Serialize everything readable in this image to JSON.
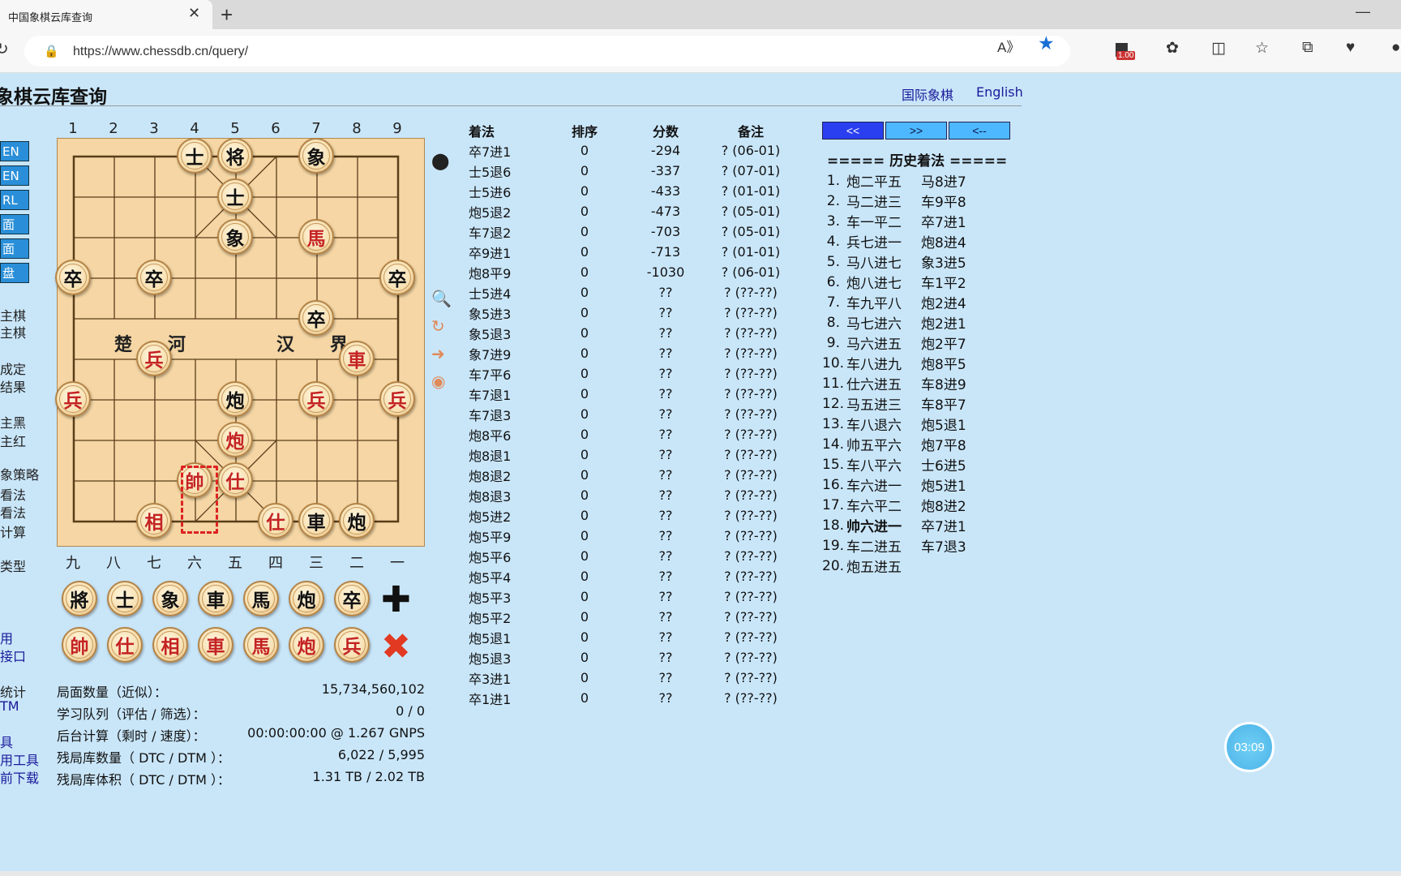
{
  "browser": {
    "tab_title": "中国象棋云库查询",
    "url": "https://www.chessdb.cn/query/",
    "ext_badge": "1.00"
  },
  "page": {
    "title": "象棋云库查询",
    "link_intl": "国际象棋",
    "link_en": "English"
  },
  "left_buttons": [
    "EN",
    "EN",
    "RL",
    "面",
    "面",
    "盘"
  ],
  "left_texts": [
    "主棋",
    "主棋",
    "成定",
    "结果",
    "主黑",
    "主红",
    "象策略",
    "看法",
    "看法",
    "计算",
    "类型",
    "用",
    "接口",
    "统计",
    "TM",
    "具",
    "用工具",
    "前下载"
  ],
  "board": {
    "top_coords": [
      "1",
      "2",
      "3",
      "4",
      "5",
      "6",
      "7",
      "8",
      "9"
    ],
    "bottom_coords": [
      "九",
      "八",
      "七",
      "六",
      "五",
      "四",
      "三",
      "二",
      "一"
    ],
    "river_text": [
      "楚",
      "河",
      "汉",
      "界"
    ],
    "pieces": [
      {
        "t": "士",
        "c": "black",
        "f": 3,
        "r": 0
      },
      {
        "t": "将",
        "c": "black",
        "f": 4,
        "r": 0
      },
      {
        "t": "象",
        "c": "black",
        "f": 6,
        "r": 0
      },
      {
        "t": "士",
        "c": "black",
        "f": 4,
        "r": 1
      },
      {
        "t": "象",
        "c": "black",
        "f": 4,
        "r": 2
      },
      {
        "t": "馬",
        "c": "red",
        "f": 6,
        "r": 2
      },
      {
        "t": "卒",
        "c": "black",
        "f": 0,
        "r": 3
      },
      {
        "t": "卒",
        "c": "black",
        "f": 2,
        "r": 3
      },
      {
        "t": "卒",
        "c": "black",
        "f": 8,
        "r": 3
      },
      {
        "t": "卒",
        "c": "black",
        "f": 6,
        "r": 4
      },
      {
        "t": "兵",
        "c": "red",
        "f": 2,
        "r": 5
      },
      {
        "t": "車",
        "c": "red",
        "f": 7,
        "r": 5
      },
      {
        "t": "兵",
        "c": "red",
        "f": 0,
        "r": 6
      },
      {
        "t": "炮",
        "c": "black",
        "f": 4,
        "r": 6
      },
      {
        "t": "兵",
        "c": "red",
        "f": 6,
        "r": 6
      },
      {
        "t": "兵",
        "c": "red",
        "f": 8,
        "r": 6
      },
      {
        "t": "炮",
        "c": "red",
        "f": 4,
        "r": 7
      },
      {
        "t": "帥",
        "c": "red",
        "f": 3,
        "r": 8
      },
      {
        "t": "仕",
        "c": "red",
        "f": 4,
        "r": 8
      },
      {
        "t": "相",
        "c": "red",
        "f": 2,
        "r": 9
      },
      {
        "t": "仕",
        "c": "red",
        "f": 5,
        "r": 9
      },
      {
        "t": "車",
        "c": "black",
        "f": 6,
        "r": 9
      },
      {
        "t": "炮",
        "c": "black",
        "f": 7,
        "r": 9
      }
    ]
  },
  "palette": {
    "black": [
      "將",
      "士",
      "象",
      "車",
      "馬",
      "炮",
      "卒"
    ],
    "red": [
      "帥",
      "仕",
      "相",
      "車",
      "馬",
      "炮",
      "兵"
    ]
  },
  "stats": [
    {
      "label": "局面数量（近似）：",
      "value": "15,734,560,102"
    },
    {
      "label": "学习队列（评估 / 筛选）：",
      "value": "0 / 0"
    },
    {
      "label": "后台计算（剩时 / 速度）：",
      "value": "00:00:00:00 @ 1.267 GNPS"
    },
    {
      "label": "残局库数量（ DTC / DTM ）：",
      "value": "6,022 / 5,995"
    },
    {
      "label": "残局库体积（ DTC / DTM ）：",
      "value": "1.31 TB / 2.02 TB"
    }
  ],
  "moves_table": {
    "headers": [
      "着法",
      "排序",
      "分数",
      "备注"
    ],
    "rows": [
      [
        "卒7进1",
        "0",
        "-294",
        "? (06-01)"
      ],
      [
        "士5退6",
        "0",
        "-337",
        "? (07-01)"
      ],
      [
        "士5进6",
        "0",
        "-433",
        "? (01-01)"
      ],
      [
        "炮5退2",
        "0",
        "-473",
        "? (05-01)"
      ],
      [
        "车7退2",
        "0",
        "-703",
        "? (05-01)"
      ],
      [
        "卒9进1",
        "0",
        "-713",
        "? (01-01)"
      ],
      [
        "炮8平9",
        "0",
        "-1030",
        "? (06-01)"
      ],
      [
        "士5进4",
        "0",
        "??",
        "? (??-??)"
      ],
      [
        "象5进3",
        "0",
        "??",
        "? (??-??)"
      ],
      [
        "象5退3",
        "0",
        "??",
        "? (??-??)"
      ],
      [
        "象7进9",
        "0",
        "??",
        "? (??-??)"
      ],
      [
        "车7平6",
        "0",
        "??",
        "? (??-??)"
      ],
      [
        "车7退1",
        "0",
        "??",
        "? (??-??)"
      ],
      [
        "车7退3",
        "0",
        "??",
        "? (??-??)"
      ],
      [
        "炮8平6",
        "0",
        "??",
        "? (??-??)"
      ],
      [
        "炮8退1",
        "0",
        "??",
        "? (??-??)"
      ],
      [
        "炮8退2",
        "0",
        "??",
        "? (??-??)"
      ],
      [
        "炮8退3",
        "0",
        "??",
        "? (??-??)"
      ],
      [
        "炮5进2",
        "0",
        "??",
        "? (??-??)"
      ],
      [
        "炮5平9",
        "0",
        "??",
        "? (??-??)"
      ],
      [
        "炮5平6",
        "0",
        "??",
        "? (??-??)"
      ],
      [
        "炮5平4",
        "0",
        "??",
        "? (??-??)"
      ],
      [
        "炮5平3",
        "0",
        "??",
        "? (??-??)"
      ],
      [
        "炮5平2",
        "0",
        "??",
        "? (??-??)"
      ],
      [
        "炮5退1",
        "0",
        "??",
        "? (??-??)"
      ],
      [
        "炮5退3",
        "0",
        "??",
        "? (??-??)"
      ],
      [
        "卒3进1",
        "0",
        "??",
        "? (??-??)"
      ],
      [
        "卒1进1",
        "0",
        "??",
        "? (??-??)"
      ]
    ]
  },
  "nav": {
    "first": "<<",
    "next": ">>",
    "back": "<--"
  },
  "history": {
    "title": "===== 历史着法 =====",
    "rows": [
      [
        "1.",
        "炮二平五",
        "马8进7"
      ],
      [
        "2.",
        "马二进三",
        "车9平8"
      ],
      [
        "3.",
        "车一平二",
        "卒7进1"
      ],
      [
        "4.",
        "兵七进一",
        "炮8进4"
      ],
      [
        "5.",
        "马八进七",
        "象3进5"
      ],
      [
        "6.",
        "炮八进七",
        "车1平2"
      ],
      [
        "7.",
        "车九平八",
        "炮2进4"
      ],
      [
        "8.",
        "马七进六",
        "炮2进1"
      ],
      [
        "9.",
        "马六进五",
        "炮2平7"
      ],
      [
        "10.",
        "车八进九",
        "炮8平5"
      ],
      [
        "11.",
        "仕六进五",
        "车8进9"
      ],
      [
        "12.",
        "马五进三",
        "车8平7"
      ],
      [
        "13.",
        "车八退六",
        "炮5退1"
      ],
      [
        "14.",
        "帅五平六",
        "炮7平8"
      ],
      [
        "15.",
        "车八平六",
        "士6进5"
      ],
      [
        "16.",
        "车六进一",
        "炮5进1"
      ],
      [
        "17.",
        "车六平二",
        "炮8进2"
      ],
      [
        "18.",
        "帅六进一",
        "卒7进1"
      ],
      [
        "19.",
        "车二进五",
        "车7退3"
      ],
      [
        "20.",
        "炮五进五",
        ""
      ]
    ]
  },
  "timer": "03:09"
}
